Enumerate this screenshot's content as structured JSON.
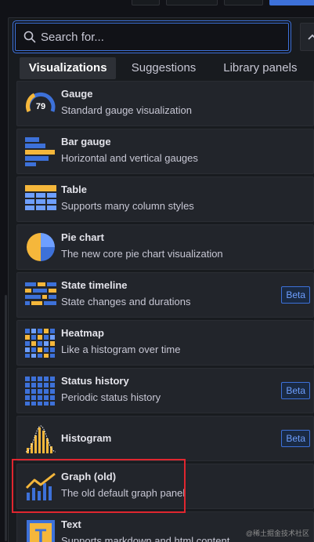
{
  "search": {
    "placeholder": "Search for..."
  },
  "tabs": [
    {
      "label": "Visualizations",
      "active": true
    },
    {
      "label": "Suggestions",
      "active": false
    },
    {
      "label": "Library panels",
      "active": false
    }
  ],
  "visualizations": [
    {
      "name": "Gauge",
      "description": "Standard gauge visualization",
      "icon": "gauge-icon",
      "icon_text": "79",
      "badge": ""
    },
    {
      "name": "Bar gauge",
      "description": "Horizontal and vertical gauges",
      "icon": "bar-gauge-icon",
      "badge": ""
    },
    {
      "name": "Table",
      "description": "Supports many column styles",
      "icon": "table-icon",
      "badge": ""
    },
    {
      "name": "Pie chart",
      "description": "The new core pie chart visualization",
      "icon": "pie-chart-icon",
      "badge": ""
    },
    {
      "name": "State timeline",
      "description": "State changes and durations",
      "icon": "state-timeline-icon",
      "badge": "Beta"
    },
    {
      "name": "Heatmap",
      "description": "Like a histogram over time",
      "icon": "heatmap-icon",
      "badge": ""
    },
    {
      "name": "Status history",
      "description": "Periodic status history",
      "icon": "status-history-icon",
      "badge": "Beta"
    },
    {
      "name": "Histogram",
      "description": "",
      "icon": "histogram-icon",
      "badge": "Beta"
    },
    {
      "name": "Graph (old)",
      "description": "The old default graph panel",
      "icon": "graph-old-icon",
      "badge": ""
    },
    {
      "name": "Text",
      "description": "Supports markdown and html content",
      "icon": "text-icon",
      "icon_text": "T",
      "badge": ""
    }
  ],
  "watermark": "@稀土掘金技术社区",
  "colors": {
    "accent": "#3d71d9",
    "highlight": "#e0262f",
    "yellow": "#f5b73b",
    "blue": "#3d71d9"
  }
}
